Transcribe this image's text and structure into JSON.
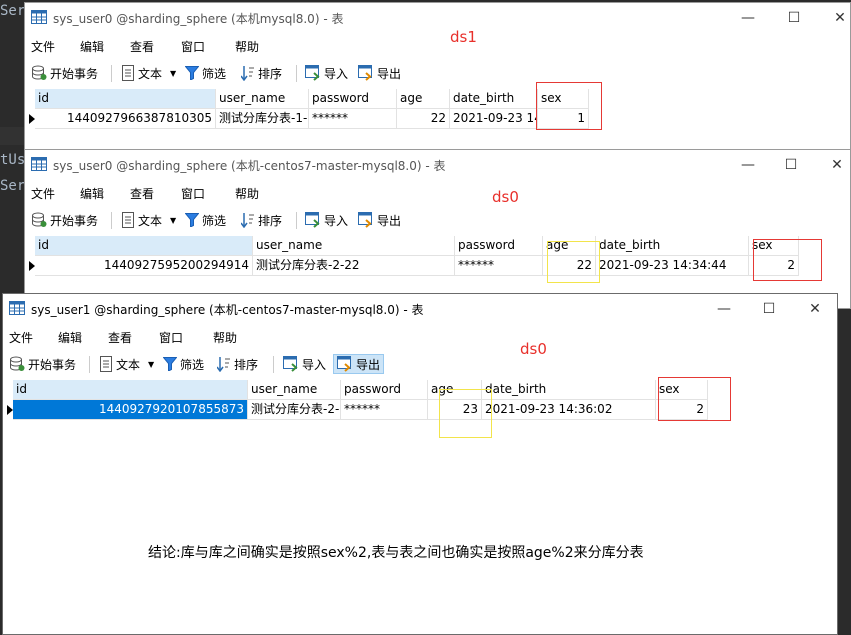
{
  "ide": {
    "lines": [
      "Ser",
      "tUs",
      "Ser"
    ]
  },
  "colors": {
    "red_label": "#e8302b",
    "red_box": "#e53935",
    "yellow_box": "#f2e44b",
    "selection": "#0078d7",
    "header_sel": "#d9ebf9"
  },
  "menu": [
    "文件",
    "编辑",
    "查看",
    "窗口",
    "帮助"
  ],
  "toolbar": {
    "begin_tx": "开始事务",
    "text": "文本",
    "filter": "筛选",
    "sort": "排序",
    "import": "导入",
    "export": "导出"
  },
  "columns": [
    "id",
    "user_name",
    "password",
    "age",
    "date_birth",
    "sex"
  ],
  "windows": [
    {
      "title": "sys_user0 @sharding_sphere (本机mysql8.0) - 表",
      "label": "ds1",
      "row": {
        "id": "1440927966387810305",
        "user_name": "测试分库分表-1-",
        "password": "******",
        "age": "22",
        "date_birth": "2021-09-23 14:",
        "sex": "1"
      }
    },
    {
      "title": "sys_user0 @sharding_sphere (本机-centos7-master-mysql8.0) - 表",
      "label": "ds0",
      "row": {
        "id": "1440927595200294914",
        "user_name": "测试分库分表-2-22",
        "password": "******",
        "age": "22",
        "date_birth": "2021-09-23 14:34:44",
        "sex": "2"
      }
    },
    {
      "title": "sys_user1 @sharding_sphere (本机-centos7-master-mysql8.0) - 表",
      "label": "ds0",
      "row": {
        "id": "1440927920107855873",
        "user_name": "测试分库分表-2-",
        "password": "******",
        "age": "23",
        "date_birth": "2021-09-23 14:36:02",
        "sex": "2"
      }
    }
  ],
  "conclusion": "结论:库与库之间确实是按照sex%2,表与表之间也确实是按照age%2来分库分表",
  "icons": [
    "table-icon",
    "minimize-icon",
    "maximize-icon",
    "close-icon",
    "transaction-icon",
    "text-icon",
    "dropdown-arrow-icon",
    "filter-icon",
    "sort-icon",
    "import-icon",
    "export-icon",
    "row-pointer-icon"
  ]
}
